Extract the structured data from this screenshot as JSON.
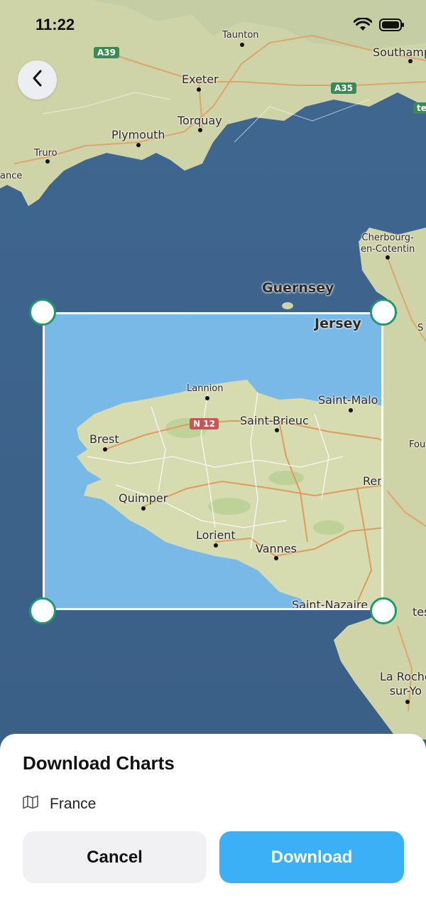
{
  "status_bar": {
    "time": "11:22"
  },
  "map": {
    "place_labels": [
      "Taunton",
      "Southamp",
      "Exeter",
      "Torquay",
      "Plymouth",
      "Truro",
      "ance",
      "Cherbourg-\nen-Cotentin",
      "Guernsey",
      "Jersey",
      "Lannion",
      "Saint-Malo",
      "Saint-Brieuc",
      "Brest",
      "Fou",
      "Rennes",
      "Quimper",
      "Lorient",
      "Vannes",
      "Saint-Nazaire",
      "tes",
      "La Roche\nsur-Yo",
      "S"
    ],
    "road_shields": [
      "A39",
      "A35",
      "tes",
      "N 12"
    ]
  },
  "sheet": {
    "title": "Download Charts",
    "region": "France",
    "cancel_label": "Cancel",
    "download_label": "Download"
  },
  "colors": {
    "accent": "#3bb0f7",
    "handle_border": "#1f9a6b",
    "sea": "#3f6387",
    "selected_sea": "#78b9e8"
  }
}
